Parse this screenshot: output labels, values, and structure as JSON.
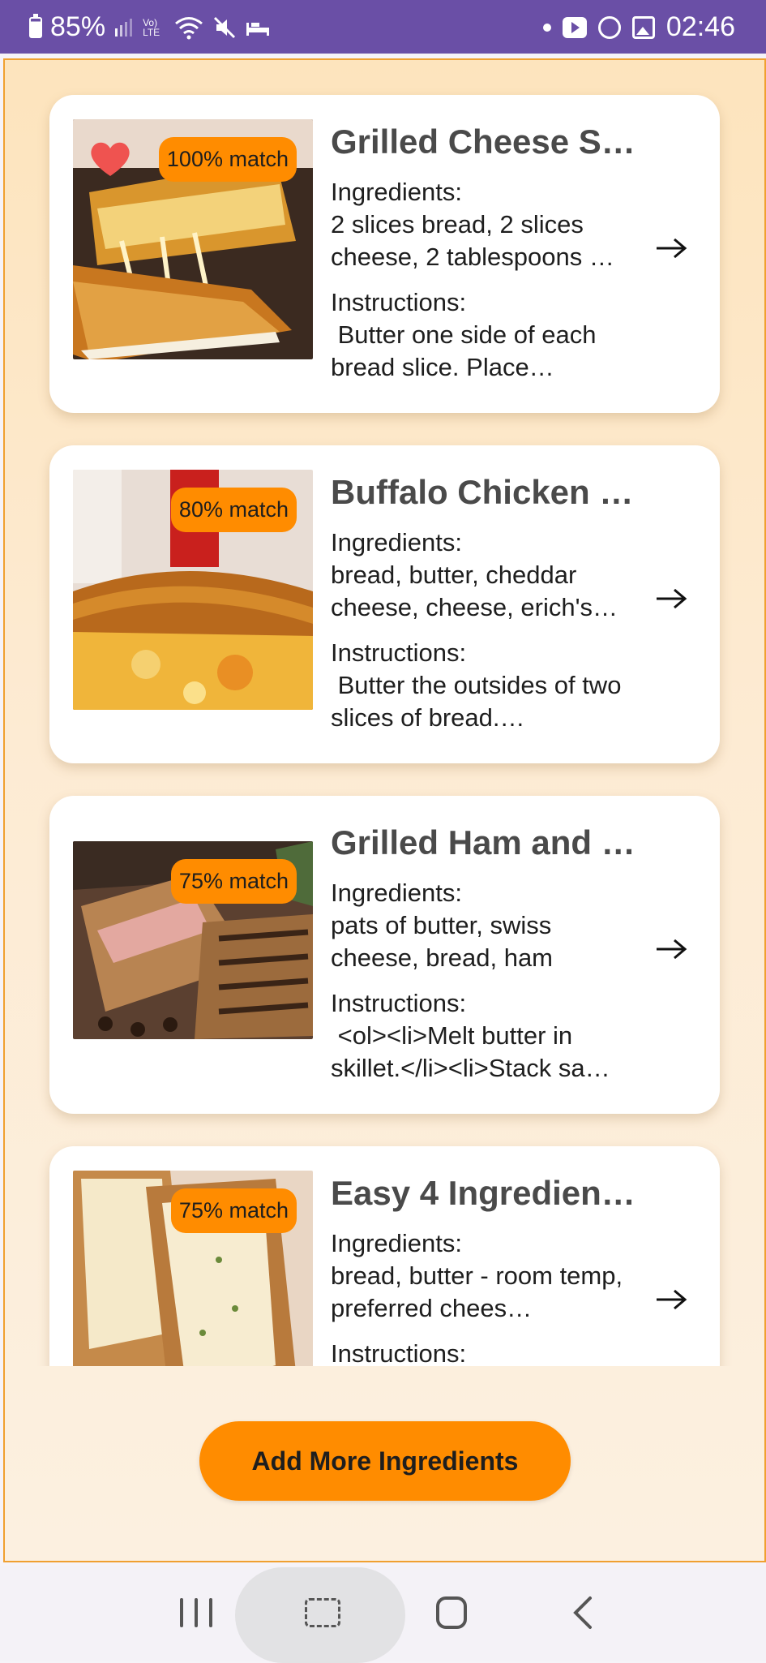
{
  "status_bar": {
    "battery": "85%",
    "time": "02:46",
    "volte": "Vo) LTE"
  },
  "recipes": [
    {
      "title": "Grilled Cheese S…",
      "match": "100% match",
      "favorited": true,
      "ingredients_label": "Ingredients:",
      "ingredients": "2 slices bread, 2 slices cheese, 2 tablespoons …",
      "instructions_label": "Instructions:",
      "instructions": " Butter one side of each bread slice. Place…",
      "image": "grilled-cheese-sandwich-photo"
    },
    {
      "title": "Buffalo Chicken …",
      "match": "80% match",
      "favorited": false,
      "ingredients_label": "Ingredients:",
      "ingredients": "bread, butter, cheddar cheese, cheese, erich's…",
      "instructions_label": "Instructions:",
      "instructions": " Butter the outsides of two slices of bread.…",
      "image": "buffalo-chicken-grilled-cheese-photo"
    },
    {
      "title": "Grilled Ham and …",
      "match": "75% match",
      "favorited": false,
      "ingredients_label": "Ingredients:",
      "ingredients": "pats of butter, swiss cheese, bread, ham",
      "instructions_label": "Instructions:",
      "instructions": " <ol><li>Melt butter in skillet.</li><li>Stack sa…",
      "image": "grilled-ham-and-cheese-photo"
    },
    {
      "title": "Easy 4 Ingredien…",
      "match": "75% match",
      "favorited": false,
      "ingredients_label": "Ingredients:",
      "ingredients": "bread, butter - room temp, preferred chees…",
      "instructions_label": "Instructions:",
      "instructions": "",
      "image": "cheese-toast-photo"
    }
  ],
  "add_button_label": "Add More Ingredients",
  "colors": {
    "accent": "#ff8c00",
    "status_bar": "#6a4fa6",
    "heart": "#ef5350"
  }
}
